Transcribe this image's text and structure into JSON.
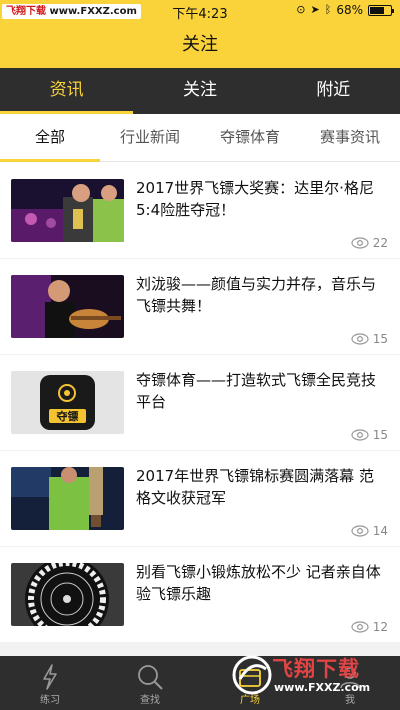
{
  "status_bar": {
    "watermark_name": "飞翔下载",
    "watermark_url": "www.FXXZ.com",
    "time": "下午4:23",
    "battery": "68%",
    "battery_level": 0.68
  },
  "header": {
    "title": "关注"
  },
  "top_tabs": [
    {
      "label": "资讯",
      "active": true
    },
    {
      "label": "关注",
      "active": false
    },
    {
      "label": "附近",
      "active": false
    }
  ],
  "sub_tabs": [
    {
      "label": "全部",
      "active": true
    },
    {
      "label": "行业新闻",
      "active": false
    },
    {
      "label": "夺镖体育",
      "active": false
    },
    {
      "label": "赛事资讯",
      "active": false
    }
  ],
  "news": [
    {
      "title": "2017世界飞镖大奖赛：达里尔·格尼5:4险胜夺冠！",
      "views": "22",
      "thumb": "trophy-players"
    },
    {
      "title": "刘泷骏——颜值与实力并存，音乐与飞镖共舞！",
      "views": "15",
      "thumb": "guitar-player"
    },
    {
      "title": "夺镖体育——打造软式飞镖全民竞技平台",
      "views": "15",
      "thumb": "duobiao-logo",
      "thumb_text": "夺镖"
    },
    {
      "title": "2017年世界飞镖锦标赛圆满落幕 范格文收获冠军",
      "views": "14",
      "thumb": "championship-trophy"
    },
    {
      "title": "别看飞镖小锻炼放松不少 记者亲自体验飞镖乐趣",
      "views": "12",
      "thumb": "dartboard"
    }
  ],
  "bottom_nav": [
    {
      "label": "练习",
      "icon": "lightning-icon",
      "active": false
    },
    {
      "label": "查找",
      "icon": "search-icon",
      "active": false
    },
    {
      "label": "广场",
      "icon": "plaza-icon",
      "active": true
    },
    {
      "label": "我",
      "icon": "user-icon",
      "active": false
    }
  ],
  "watermark_bottom": {
    "name": "飞翔下载",
    "url": "www.FXXZ.com"
  },
  "colors": {
    "accent": "#f9d339",
    "dark_bar": "#2e2e2e",
    "text": "#111111",
    "muted": "#888888"
  }
}
